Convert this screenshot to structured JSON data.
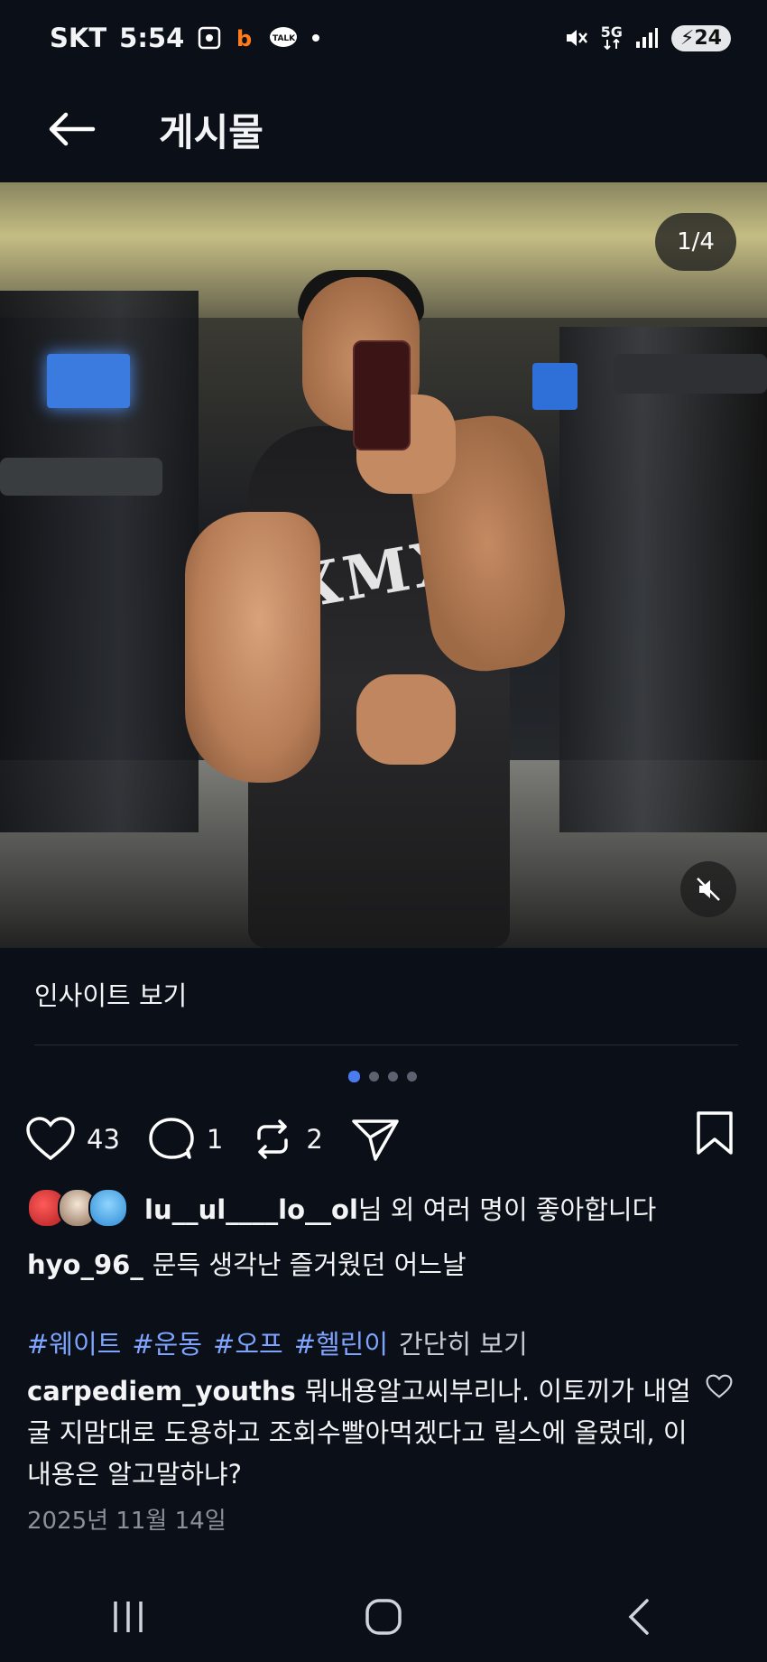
{
  "status_bar": {
    "carrier": "SKT",
    "time": "5:54",
    "network": "5G",
    "battery": "24"
  },
  "header": {
    "title": "게시물"
  },
  "media": {
    "counter": "1/4",
    "tank_print": "XMXL"
  },
  "insight_label": "인사이트 보기",
  "actions": {
    "like_count": "43",
    "comment_count": "1",
    "repost_count": "2"
  },
  "likes": {
    "user": "lu__ul____lo__ol",
    "suffix": "님 외 여러 명이 좋아합니다"
  },
  "caption": {
    "user": "hyo_96_",
    "text": "문득 생각난 즐거웠던 어느날"
  },
  "tags": [
    "#웨이트",
    "#운동",
    "#오프",
    "#헬린이"
  ],
  "more_label": "간단히 보기",
  "comment": {
    "user": "carpediem_youths",
    "text": "뭐내용알고씨부리나. 이토끼가 내얼굴 지맘대로 도용하고 조회수빨아먹겠다고 릴스에 올렸데, 이내용은 알고말하냐?"
  },
  "date": "2025년 11월 14일",
  "colors": {
    "background": "#0b0f17",
    "accent_blue": "#7ea4ff",
    "dot_active": "#4a7cf0"
  }
}
